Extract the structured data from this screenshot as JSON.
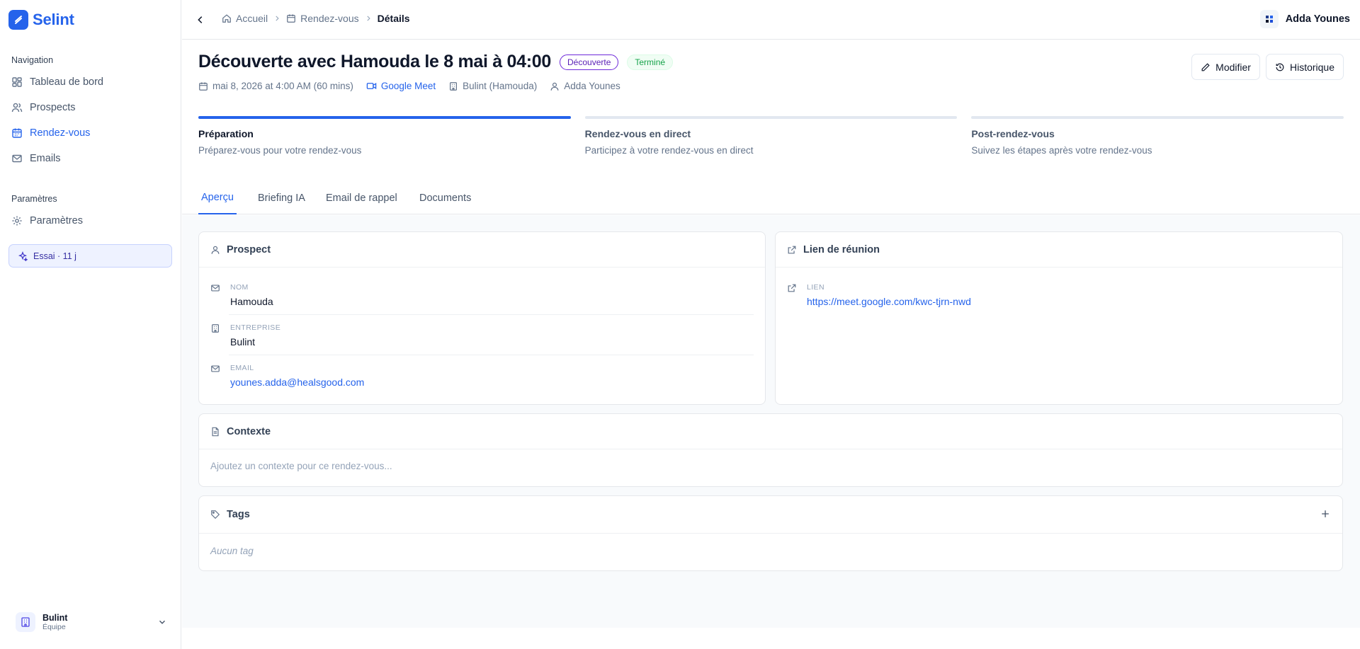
{
  "brand": {
    "name": "Selint",
    "color": "#2563eb"
  },
  "sidebar": {
    "nav_title": "Navigation",
    "items": [
      {
        "label": "Tableau de bord",
        "icon": "dashboard-icon"
      },
      {
        "label": "Prospects",
        "icon": "users-icon"
      },
      {
        "label": "Rendez-vous",
        "icon": "calendar-icon",
        "active": true
      },
      {
        "label": "Emails",
        "icon": "mail-icon"
      }
    ],
    "settings_title": "Paramètres",
    "settings_item": {
      "label": "Paramètres",
      "icon": "gear-icon"
    },
    "trial": "Essai · 11 j",
    "team": {
      "name": "Bulint",
      "role": "Équipe"
    }
  },
  "header": {
    "breadcrumb": [
      "Accueil",
      "Rendez-vous",
      "Détails"
    ],
    "user": "Adda Younes"
  },
  "meeting": {
    "title": "Découverte avec Hamouda le 8 mai à 04:00",
    "type_badge": "Découverte",
    "status_badge": "Terminé",
    "datetime": "mai 8, 2026 at 4:00 AM (60 mins)",
    "platform": "Google Meet",
    "company": "Bulint (Hamouda)",
    "owner": "Adda Younes"
  },
  "actions": {
    "edit": "Modifier",
    "history": "Historique"
  },
  "steps": [
    {
      "title": "Préparation",
      "subtitle": "Préparez-vous pour votre rendez-vous",
      "active": true
    },
    {
      "title": "Rendez-vous en direct",
      "subtitle": "Participez à votre rendez-vous en direct"
    },
    {
      "title": "Post-rendez-vous",
      "subtitle": "Suivez les étapes après votre rendez-vous"
    }
  ],
  "tabs": [
    "Aperçu",
    "Briefing IA",
    "Email de rappel",
    "Documents"
  ],
  "prospect_card": {
    "title": "Prospect",
    "fields": [
      {
        "label": "Nom",
        "value": "Hamouda"
      },
      {
        "label": "Entreprise",
        "value": "Bulint"
      },
      {
        "label": "Email",
        "value": "younes.adda@healsgood.com"
      }
    ]
  },
  "link_card": {
    "title": "Lien de réunion",
    "label": "Lien",
    "value": "https://meet.google.com/kwc-tjrn-nwd"
  },
  "context_card": {
    "title": "Contexte",
    "placeholder": "Ajoutez un contexte pour ce rendez-vous..."
  },
  "tags_card": {
    "title": "Tags",
    "empty": "Aucun tag"
  }
}
